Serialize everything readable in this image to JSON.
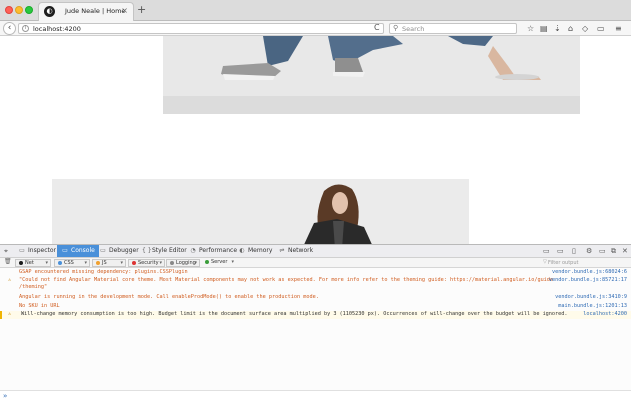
{
  "browser": {
    "tab_title": "Jude Neale | Home",
    "tab_close": "×",
    "new_tab": "+",
    "favicon": "◐",
    "url": "localhost:4200",
    "search_placeholder": "Search"
  },
  "nav_icons": {
    "back": "‹",
    "info": "i",
    "reload": "C",
    "search": "⚲",
    "bookmark": "☆",
    "library": "▤",
    "download": "⇣",
    "home": "⌂",
    "pocket": "◇",
    "sync": "▭",
    "menu": "≡"
  },
  "devtools": {
    "tabs": [
      {
        "label": "Inspector",
        "icon": "▭"
      },
      {
        "label": "Console",
        "icon": "▭"
      },
      {
        "label": "Debugger",
        "icon": "▭"
      },
      {
        "label": "Style Editor",
        "icon": "{ }"
      },
      {
        "label": "Performance",
        "icon": "◔"
      },
      {
        "label": "Memory",
        "icon": "◐"
      },
      {
        "label": "Network",
        "icon": "⇌"
      }
    ],
    "active_tab": "Console",
    "filters": [
      {
        "label": "Net",
        "color": "#1a1a1a"
      },
      {
        "label": "CSS",
        "color": "#4a90d9"
      },
      {
        "label": "JS",
        "color": "#f0a030"
      },
      {
        "label": "Security",
        "color": "#d33"
      },
      {
        "label": "Logging",
        "color": "#888888"
      },
      {
        "label": "Server",
        "color": "#3a9d3a"
      }
    ],
    "filter_placeholder": "Filter output",
    "trash_icon": "🗑",
    "prompt": "»",
    "right_icons": [
      "▭",
      "▭",
      "▯",
      "⚙",
      "▭",
      "⧉",
      "✕"
    ]
  },
  "console": [
    {
      "level": "error",
      "message": "GSAP encountered missing dependency: plugins.CSSPlugin",
      "source": "vendor.bundle.js:68024:6"
    },
    {
      "level": "warn",
      "message": "\"Could not find Angular Material core theme. Most Material components may not work as expected. For more info refer to the theming guide: https://material.angular.io/guide",
      "message2": "/theming\"",
      "source": "vendor.bundle.js:85721:17"
    },
    {
      "level": "error",
      "message": "Angular is running in the development mode. Call enableProdMode() to enable the production mode.",
      "source": "vendor.bundle.js:3410:9"
    },
    {
      "level": "error",
      "message": "No SKU in URL",
      "source": "main.bundle.js:1201:13"
    },
    {
      "level": "warn2",
      "message": "Will-change memory consumption is too high. Budget limit is the document surface area multiplied by 3 (1105230 px). Occurrences of will-change over the budget will be ignored.",
      "source": "localhost:4200"
    }
  ]
}
